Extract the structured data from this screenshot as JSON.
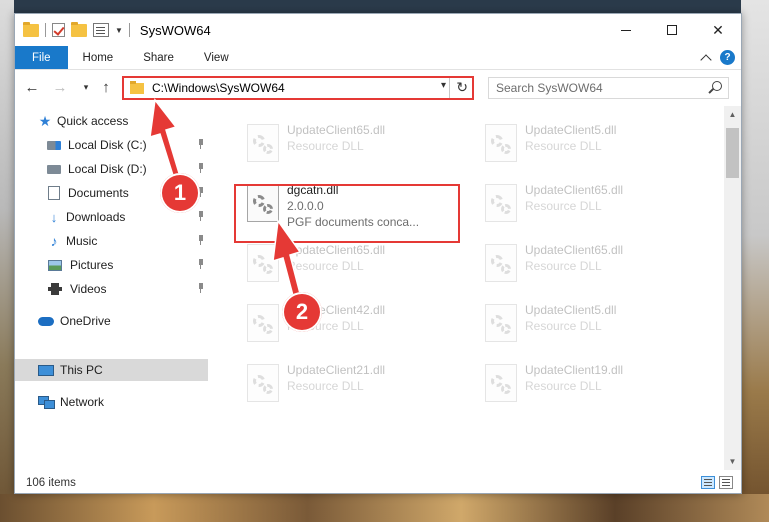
{
  "window": {
    "title": "SysWOW64",
    "controls": {
      "minimize": "minimize",
      "maximize": "maximize",
      "close": "✕"
    }
  },
  "ribbon": {
    "tabs": [
      "File",
      "Home",
      "Share",
      "View"
    ],
    "help": "?"
  },
  "address": {
    "path": "C:\\Windows\\SysWOW64",
    "search_placeholder": "Search SysWOW64"
  },
  "nav": {
    "items": [
      {
        "label": "Quick access",
        "icon": "star-icon",
        "pinned": false
      },
      {
        "label": "Local Disk (C:)",
        "icon": "disk-icon",
        "pinned": true
      },
      {
        "label": "Local Disk (D:)",
        "icon": "disk-icon",
        "pinned": true
      },
      {
        "label": "Documents",
        "icon": "documents-icon",
        "pinned": true
      },
      {
        "label": "Downloads",
        "icon": "download-icon",
        "pinned": true
      },
      {
        "label": "Music",
        "icon": "music-icon",
        "pinned": true
      },
      {
        "label": "Pictures",
        "icon": "pictures-icon",
        "pinned": true
      },
      {
        "label": "Videos",
        "icon": "videos-icon",
        "pinned": true
      },
      {
        "label": "OneDrive",
        "icon": "cloud-icon",
        "pinned": false
      },
      {
        "label": "This PC",
        "icon": "pc-icon",
        "pinned": false,
        "selected": true
      },
      {
        "label": "Network",
        "icon": "network-icon",
        "pinned": false
      }
    ]
  },
  "files": {
    "highlighted": {
      "name": "dgcatn.dll",
      "version": "2.0.0.0",
      "description": "PGF documents conca..."
    },
    "faded": [
      {
        "name": "UpdateClient65.dll",
        "type": "Resource DLL"
      },
      {
        "name": "UpdateClient5.dll",
        "type": "Resource DLL"
      },
      {
        "name": "UpdateClient65.dll",
        "type": "Resource DLL"
      },
      {
        "name": "UpdateClient65.dll",
        "type": "Resource DLL"
      },
      {
        "name": "UpdateClient65.dll",
        "type": "Resource DLL"
      },
      {
        "name": "UpdateClient42.dll",
        "type": "Resource DLL"
      },
      {
        "name": "UpdateClient5.dll",
        "type": "Resource DLL"
      },
      {
        "name": "UpdateClient21.dll",
        "type": "Resource DLL"
      },
      {
        "name": "UpdateClient19.dll",
        "type": "Resource DLL"
      }
    ]
  },
  "status": {
    "count": "106 items"
  },
  "callouts": {
    "one": "1",
    "two": "2"
  },
  "colors": {
    "accent": "#1979ca",
    "highlight": "#e53935",
    "selected_nav": "#d9d9d9"
  }
}
